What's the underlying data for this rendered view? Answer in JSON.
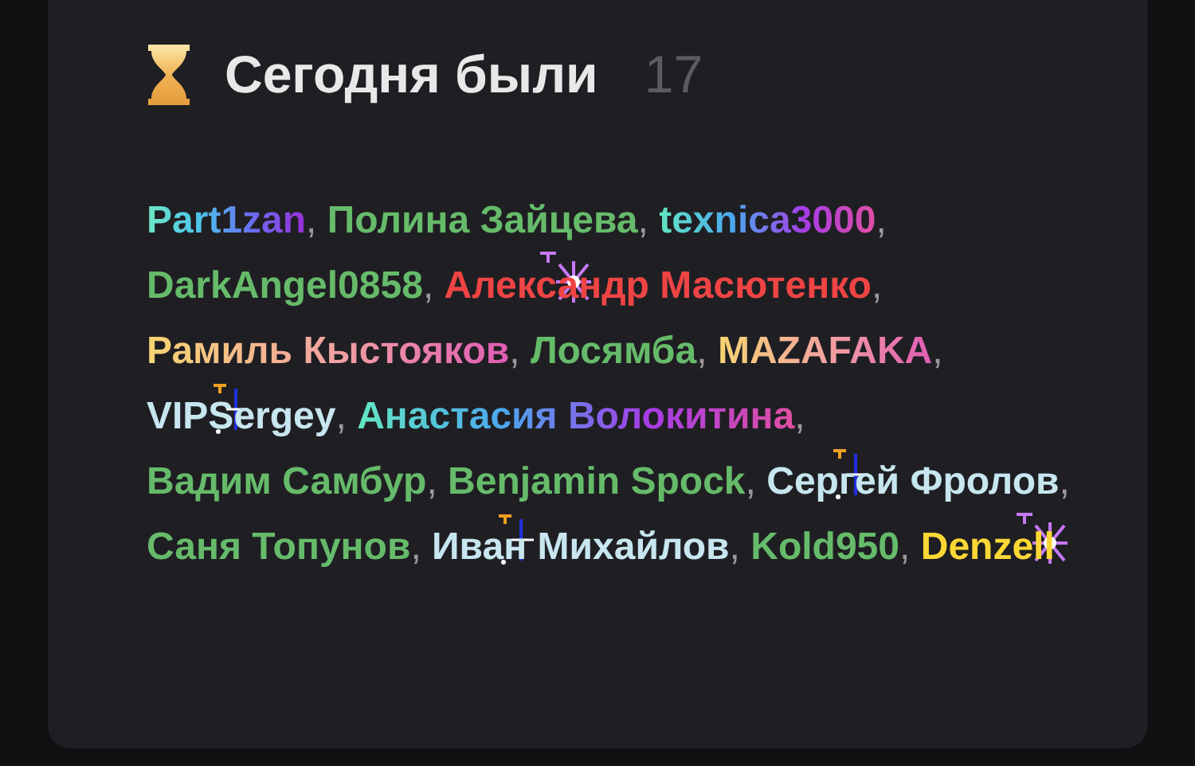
{
  "panel": {
    "title": "Сегодня были",
    "count": "17"
  },
  "users": [
    {
      "name": "Part1zan",
      "kind": "cool",
      "separator": ","
    },
    {
      "name": "Полина Зайцева",
      "kind": "solid",
      "color": "#66bb6a",
      "separator": ","
    },
    {
      "name": "texnica3000",
      "kind": "rainbow",
      "separator": ","
    },
    {
      "name": "DarkAngel0858",
      "kind": "solid",
      "color": "#66bb6a",
      "separator": ","
    },
    {
      "name": "Александр Масютенко",
      "kind": "solid",
      "color": "#ef4444",
      "sparkle": {
        "kind": "star",
        "color": "#c678f5"
      },
      "separator": ","
    },
    {
      "name": "Рамиль Кыстояков",
      "kind": "warm",
      "separator": ","
    },
    {
      "name": "Лосямба",
      "kind": "solid",
      "color": "#66bb6a",
      "separator": ","
    },
    {
      "name": "MAZAFAKA",
      "kind": "warm",
      "separator": ","
    },
    {
      "name": "VIPSergey",
      "kind": "solid",
      "color": "#c7e6ef",
      "sparkle": {
        "kind": "line",
        "color": "#2030e0"
      },
      "separator": ","
    },
    {
      "name": "Анастасия Волокитина",
      "kind": "rainbow",
      "separator": ","
    },
    {
      "name": "Вадим Самбур",
      "kind": "solid",
      "color": "#66bb6a",
      "separator": ","
    },
    {
      "name": "Benjamin Spock",
      "kind": "solid",
      "color": "#66bb6a",
      "separator": ","
    },
    {
      "name": "Сергей Фролов",
      "kind": "solid",
      "color": "#c7e6ef",
      "sparkle": {
        "kind": "line",
        "color": "#2030e0"
      },
      "separator": ","
    },
    {
      "name": "Саня Топунов",
      "kind": "solid",
      "color": "#66bb6a",
      "separator": ","
    },
    {
      "name": "Иван Михайлов",
      "kind": "solid",
      "color": "#c7e6ef",
      "sparkle": {
        "kind": "line",
        "color": "#2030e0"
      },
      "separator": ","
    },
    {
      "name": "Kold950",
      "kind": "solid",
      "color": "#66bb6a",
      "separator": ","
    },
    {
      "name": "Denzell",
      "kind": "solid",
      "color": "#fdd835",
      "sparkle": {
        "kind": "star",
        "color": "#c678f5"
      }
    }
  ]
}
